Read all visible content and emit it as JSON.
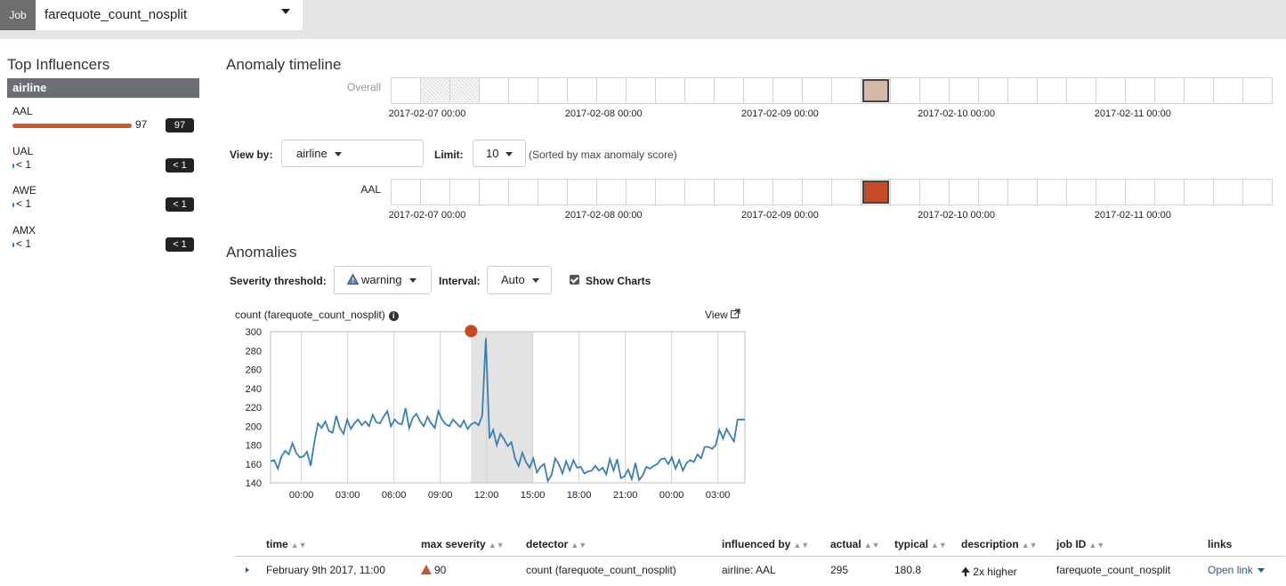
{
  "job": {
    "label": "Job",
    "selected": "farequote_count_nosplit"
  },
  "influencers": {
    "title": "Top Influencers",
    "field": "airline",
    "items": [
      {
        "name": "AAL",
        "value": "97",
        "badge": "97",
        "score": 97
      },
      {
        "name": "UAL",
        "value": "< 1",
        "badge": "< 1",
        "score": 0.5
      },
      {
        "name": "AWE",
        "value": "< 1",
        "badge": "< 1",
        "score": 0.5
      },
      {
        "name": "AMX",
        "value": "< 1",
        "badge": "< 1",
        "score": 0.5
      }
    ]
  },
  "timeline": {
    "title": "Anomaly timeline",
    "overall_label": "Overall",
    "aal_label": "AAL",
    "cell_count": 30,
    "date_labels": [
      "2017-02-07 00:00",
      "2017-02-08 00:00",
      "2017-02-09 00:00",
      "2017-02-10 00:00",
      "2017-02-11 00:00"
    ],
    "overall_cells": [
      {
        "index": 16,
        "color": "#d3b9a6"
      }
    ],
    "overall_hatched": [
      1,
      2
    ],
    "aal_cells": [
      {
        "index": 16,
        "color": "#c64a25"
      }
    ]
  },
  "view_by": {
    "label": "View by:",
    "value": "airline",
    "limit_label": "Limit:",
    "limit_value": "10",
    "note": "(Sorted by max anomaly score)"
  },
  "anomalies": {
    "title": "Anomalies",
    "severity_label": "Severity threshold:",
    "severity_value": "warning",
    "interval_label": "Interval:",
    "interval_value": "Auto",
    "show_charts_label": "Show Charts",
    "show_charts": true
  },
  "chart": {
    "title": "count (farequote_count_nosplit)",
    "view_link": "View"
  },
  "chart_data": {
    "type": "line",
    "title": "count (farequote_count_nosplit)",
    "ylim": [
      140,
      300
    ],
    "yticks": [
      140,
      160,
      180,
      200,
      220,
      240,
      260,
      280,
      300
    ],
    "xtick_labels": [
      "00:00",
      "03:00",
      "06:00",
      "09:00",
      "12:00",
      "15:00",
      "18:00",
      "21:00",
      "00:00",
      "03:00"
    ],
    "xtick_hours": [
      0,
      3,
      6,
      9,
      12,
      15,
      18,
      21,
      24,
      27
    ],
    "x_range_hours": [
      -2,
      28.75
    ],
    "highlight_hours": [
      11,
      15
    ],
    "anomaly_point": {
      "x_hours": 11,
      "y": 295,
      "color": "#c64a25"
    },
    "line_color": "#3a7fb0",
    "series": [
      {
        "values": [
          163,
          164,
          155,
          168,
          174,
          170,
          182,
          172,
          167,
          168,
          173,
          158,
          183,
          203,
          198,
          205,
          195,
          193,
          211,
          198,
          192,
          207,
          197,
          203,
          207,
          201,
          205,
          200,
          212,
          204,
          203,
          210,
          216,
          200,
          207,
          203,
          202,
          219,
          198,
          209,
          213,
          205,
          200,
          210,
          203,
          198,
          216,
          207,
          202,
          200,
          207,
          203,
          199,
          206,
          197,
          202,
          204,
          201,
          211,
          293,
          187,
          196,
          180,
          192,
          186,
          179,
          183,
          166,
          158,
          172,
          162,
          156,
          166,
          151,
          157,
          160,
          142,
          148,
          166,
          160,
          150,
          163,
          153,
          164,
          156,
          157,
          150,
          152,
          153,
          158,
          153,
          156,
          149,
          165,
          153,
          165,
          145,
          147,
          154,
          144,
          161,
          143,
          148,
          157,
          155,
          158,
          160,
          165,
          166,
          160,
          167,
          155,
          164,
          153,
          161,
          164,
          162,
          170,
          166,
          178,
          178,
          176,
          180,
          196,
          187,
          197,
          190,
          184,
          207,
          207,
          207
        ]
      }
    ]
  },
  "table": {
    "headers": [
      "time",
      "max severity",
      "detector",
      "influenced by",
      "actual",
      "typical",
      "description",
      "job ID",
      "links"
    ],
    "row": {
      "time": "February 9th 2017, 11:00",
      "severity": "90",
      "detector": "count (farequote_count_nosplit)",
      "influenced_by": "airline: AAL",
      "actual": "295",
      "typical": "180.8",
      "description": "2x higher",
      "job_id": "farequote_count_nosplit",
      "links": "Open link"
    }
  }
}
